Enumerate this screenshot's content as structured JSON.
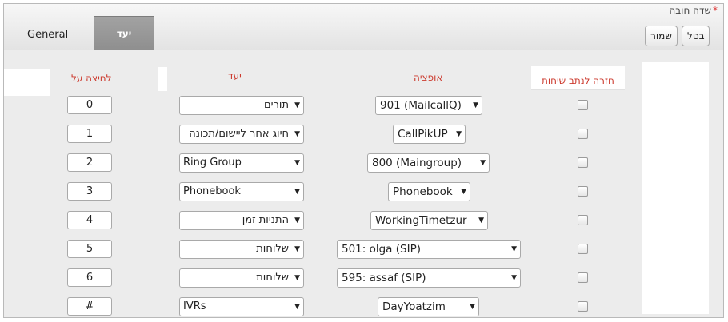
{
  "header": {
    "tab_general": "General",
    "tab_destination": "יעד",
    "required_label": "שדה חובה",
    "required_star": "*",
    "cancel_label": "בטל",
    "save_label": "שמור"
  },
  "columns": {
    "keypress": "לחיצה על",
    "destination": "יעד",
    "option": "אופציה",
    "return_to_route": "חזרה לנתב שיחות"
  },
  "rows": [
    {
      "key": "0",
      "destination": "תורים",
      "option": "901 (MailcallQ)",
      "return_checked": false
    },
    {
      "key": "1",
      "destination": "חיוג אחר ליישום/תכונה",
      "option": "CallPikUP",
      "return_checked": false
    },
    {
      "key": "2",
      "destination": "Ring Group",
      "option": "800 (Maingroup)",
      "return_checked": false
    },
    {
      "key": "3",
      "destination": "Phonebook",
      "option": "Phonebook",
      "return_checked": false
    },
    {
      "key": "4",
      "destination": "התניות זמן",
      "option": "WorkingTimetzur",
      "return_checked": false
    },
    {
      "key": "5",
      "destination": "שלוחות",
      "option": "501: olga (SIP)",
      "return_checked": false
    },
    {
      "key": "6",
      "destination": "שלוחות",
      "option": "595: assaf (SIP)",
      "return_checked": false
    },
    {
      "key": "#",
      "destination": "IVRs",
      "option": "DayYoatzim",
      "return_checked": false
    }
  ],
  "icons": {
    "dropdown_arrow": "▼"
  }
}
